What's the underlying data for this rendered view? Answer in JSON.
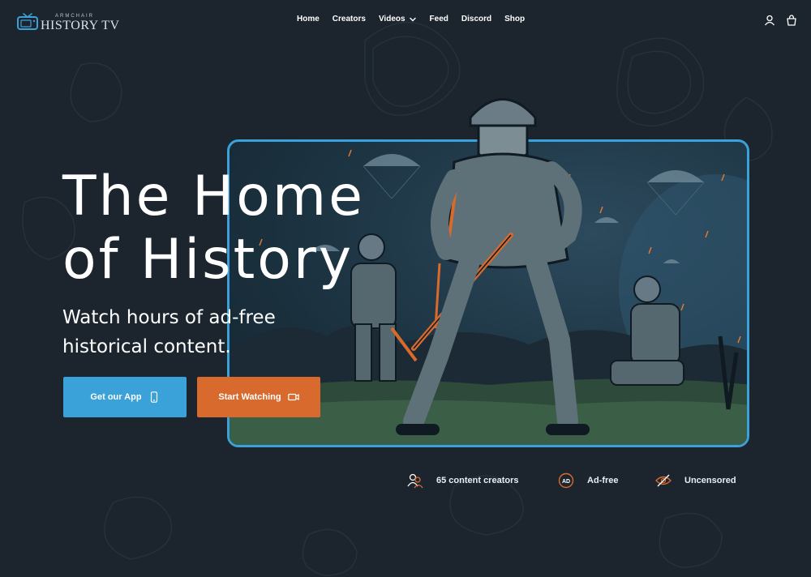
{
  "logo": {
    "small_text": "ARMCHAIR",
    "big_text": "HISTORY TV"
  },
  "nav": {
    "items": [
      "Home",
      "Creators",
      "Videos",
      "Feed",
      "Discord",
      "Shop"
    ]
  },
  "hero": {
    "title_line1": "The Home",
    "title_line2": "of History",
    "subtitle": "Watch hours of ad-free historical content.",
    "app_button": "Get our App",
    "watch_button": "Start Watching"
  },
  "features": {
    "creators": "65 content creators",
    "adfree": "Ad-free",
    "adfree_badge": "AD",
    "uncensored": "Uncensored"
  },
  "colors": {
    "background": "#1c252e",
    "accent_blue": "#3aa1d9",
    "accent_orange": "#d86a2e"
  }
}
